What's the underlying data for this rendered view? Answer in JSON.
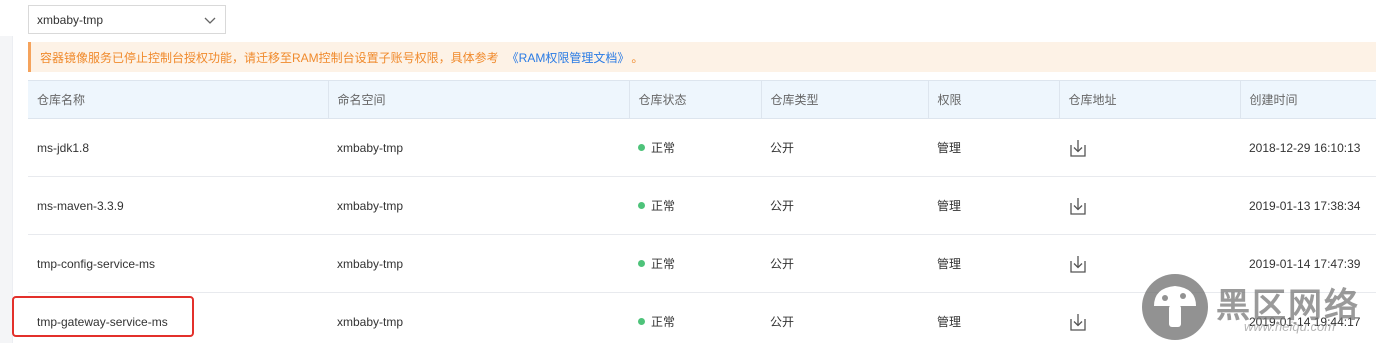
{
  "namespace_select": {
    "value": "xmbaby-tmp"
  },
  "notice": {
    "text": "容器镜像服务已停止控制台授权功能，请迁移至RAM控制台设置子账号权限，具体参考",
    "link": "《RAM权限管理文档》",
    "tail": "。"
  },
  "table": {
    "headers": [
      "仓库名称",
      "命名空间",
      "仓库状态",
      "仓库类型",
      "权限",
      "仓库地址",
      "创建时间"
    ],
    "rows": [
      {
        "name": "ms-jdk1.8",
        "namespace": "xmbaby-tmp",
        "status": "正常",
        "type": "公开",
        "permission": "管理",
        "created": "2018-12-29 16:10:13"
      },
      {
        "name": "ms-maven-3.3.9",
        "namespace": "xmbaby-tmp",
        "status": "正常",
        "type": "公开",
        "permission": "管理",
        "created": "2019-01-13 17:38:34"
      },
      {
        "name": "tmp-config-service-ms",
        "namespace": "xmbaby-tmp",
        "status": "正常",
        "type": "公开",
        "permission": "管理",
        "created": "2019-01-14 17:47:39"
      },
      {
        "name": "tmp-gateway-service-ms",
        "namespace": "xmbaby-tmp",
        "status": "正常",
        "type": "公开",
        "permission": "管理",
        "created": "2019-01-14 19:44:17"
      }
    ]
  },
  "colors": {
    "status_ok": "#4ec37a",
    "highlight": "#e3302b",
    "notice_text": "#f08a2c",
    "link": "#2a7be4"
  },
  "watermark": {
    "text": "黑区网络",
    "url": "www.heiqu.com"
  },
  "icons": {
    "select": "chevron-down-icon",
    "address": "download-icon",
    "watermark": "mushroom-logo"
  }
}
